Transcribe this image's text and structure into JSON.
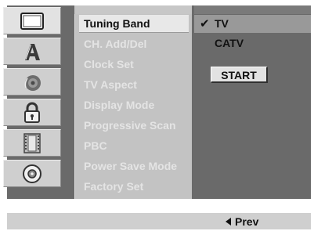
{
  "categories": [
    {
      "icon": "tv-screen-icon"
    },
    {
      "icon": "language-a-icon"
    },
    {
      "icon": "speaker-icon"
    },
    {
      "icon": "padlock-icon"
    },
    {
      "icon": "film-strip-icon"
    },
    {
      "icon": "disc-icon"
    }
  ],
  "menu": {
    "items": [
      {
        "label": "Tuning Band"
      },
      {
        "label": "CH. Add/Del"
      },
      {
        "label": "Clock Set"
      },
      {
        "label": "TV Aspect"
      },
      {
        "label": "Display Mode"
      },
      {
        "label": "Progressive Scan"
      },
      {
        "label": "PBC"
      },
      {
        "label": "Power Save Mode"
      },
      {
        "label": "Factory Set"
      }
    ],
    "selected_index": 0
  },
  "options": {
    "items": [
      {
        "label": "TV",
        "checked": true
      },
      {
        "label": "CATV",
        "checked": false
      }
    ],
    "check_glyph": "✔",
    "start_label": "START"
  },
  "footer": {
    "prev_label": "Prev"
  },
  "colors": {
    "screen_bg": "#6a6a6a",
    "menu_bg": "#c3c3c3",
    "highlight": "#e8e8e8",
    "option_highlight": "#999999"
  }
}
